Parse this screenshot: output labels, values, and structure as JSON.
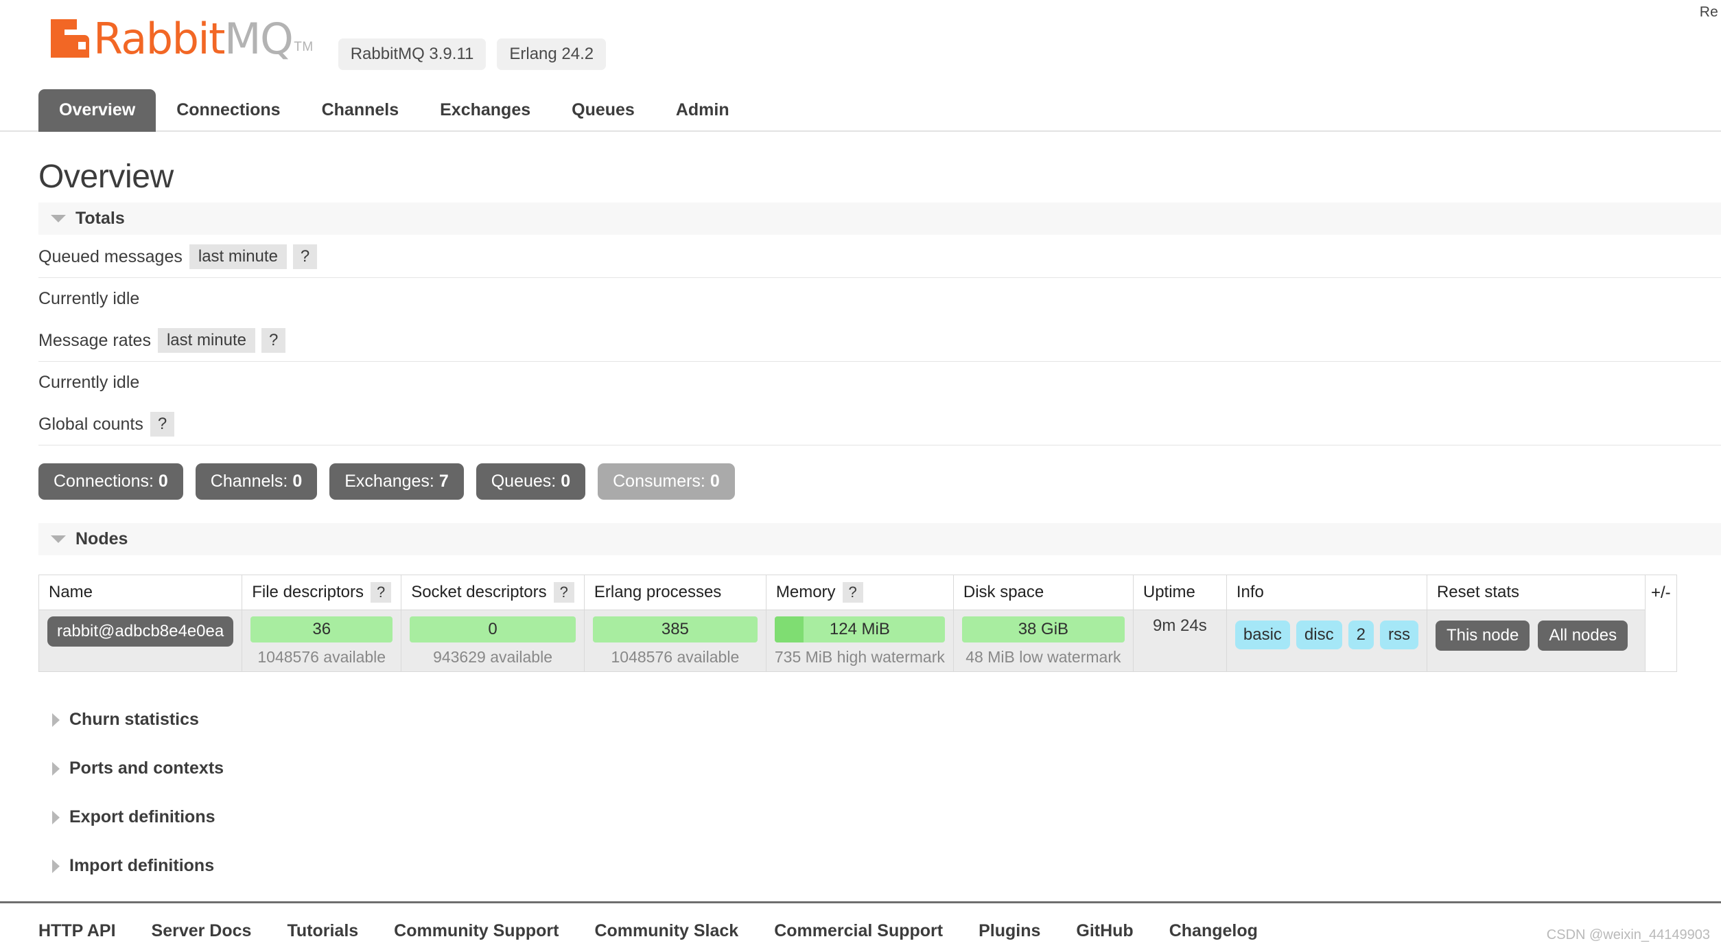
{
  "corner_note": "Re",
  "brand": {
    "name_orange": "Rabbit",
    "name_grey": "MQ",
    "tm": "TM",
    "rabbitmq_version": "RabbitMQ 3.9.11",
    "erlang_version": "Erlang 24.2",
    "accent_color": "#f26725"
  },
  "nav": {
    "items": [
      {
        "label": "Overview",
        "active": true
      },
      {
        "label": "Connections",
        "active": false
      },
      {
        "label": "Channels",
        "active": false
      },
      {
        "label": "Exchanges",
        "active": false
      },
      {
        "label": "Queues",
        "active": false
      },
      {
        "label": "Admin",
        "active": false
      }
    ]
  },
  "page": {
    "title": "Overview"
  },
  "totals": {
    "section_label": "Totals",
    "queued_messages_label": "Queued messages",
    "queued_messages_period": "last minute",
    "queued_messages_help": "?",
    "queued_idle_text": "Currently idle",
    "message_rates_label": "Message rates",
    "message_rates_period": "last minute",
    "message_rates_help": "?",
    "rates_idle_text": "Currently idle",
    "global_counts_label": "Global counts",
    "global_counts_help": "?",
    "counts": [
      {
        "label": "Connections:",
        "value": "0",
        "muted": false
      },
      {
        "label": "Channels:",
        "value": "0",
        "muted": false
      },
      {
        "label": "Exchanges:",
        "value": "7",
        "muted": false
      },
      {
        "label": "Queues:",
        "value": "0",
        "muted": false
      },
      {
        "label": "Consumers:",
        "value": "0",
        "muted": true
      }
    ]
  },
  "nodes": {
    "section_label": "Nodes",
    "columns": {
      "name": "Name",
      "file_descriptors": "File descriptors",
      "file_descriptors_help": "?",
      "socket_descriptors": "Socket descriptors",
      "socket_descriptors_help": "?",
      "erlang_processes": "Erlang processes",
      "memory": "Memory",
      "memory_help": "?",
      "disk_space": "Disk space",
      "uptime": "Uptime",
      "info": "Info",
      "reset_stats": "Reset stats"
    },
    "expand_toggle": "+/-",
    "row": {
      "name": "rabbit@adbcb8e4e0ea",
      "file_descriptors_value": "36",
      "file_descriptors_sub": "1048576 available",
      "socket_descriptors_value": "0",
      "socket_descriptors_sub": "943629 available",
      "erlang_processes_value": "385",
      "erlang_processes_sub": "1048576 available",
      "memory_value": "124 MiB",
      "memory_sub": "735 MiB high watermark",
      "memory_fill_pct": "17%",
      "disk_value": "38 GiB",
      "disk_sub": "48 MiB low watermark",
      "uptime_value": "9m 24s",
      "info_badges": [
        "basic",
        "disc",
        "2",
        "rss"
      ],
      "reset_buttons": [
        "This node",
        "All nodes"
      ]
    }
  },
  "collapsed_sections": [
    {
      "label": "Churn statistics"
    },
    {
      "label": "Ports and contexts"
    },
    {
      "label": "Export definitions"
    },
    {
      "label": "Import definitions"
    }
  ],
  "footer": {
    "links": [
      "HTTP API",
      "Server Docs",
      "Tutorials",
      "Community Support",
      "Community Slack",
      "Commercial Support",
      "Plugins",
      "GitHub",
      "Changelog"
    ]
  },
  "watermark": "CSDN @weixin_44149903"
}
